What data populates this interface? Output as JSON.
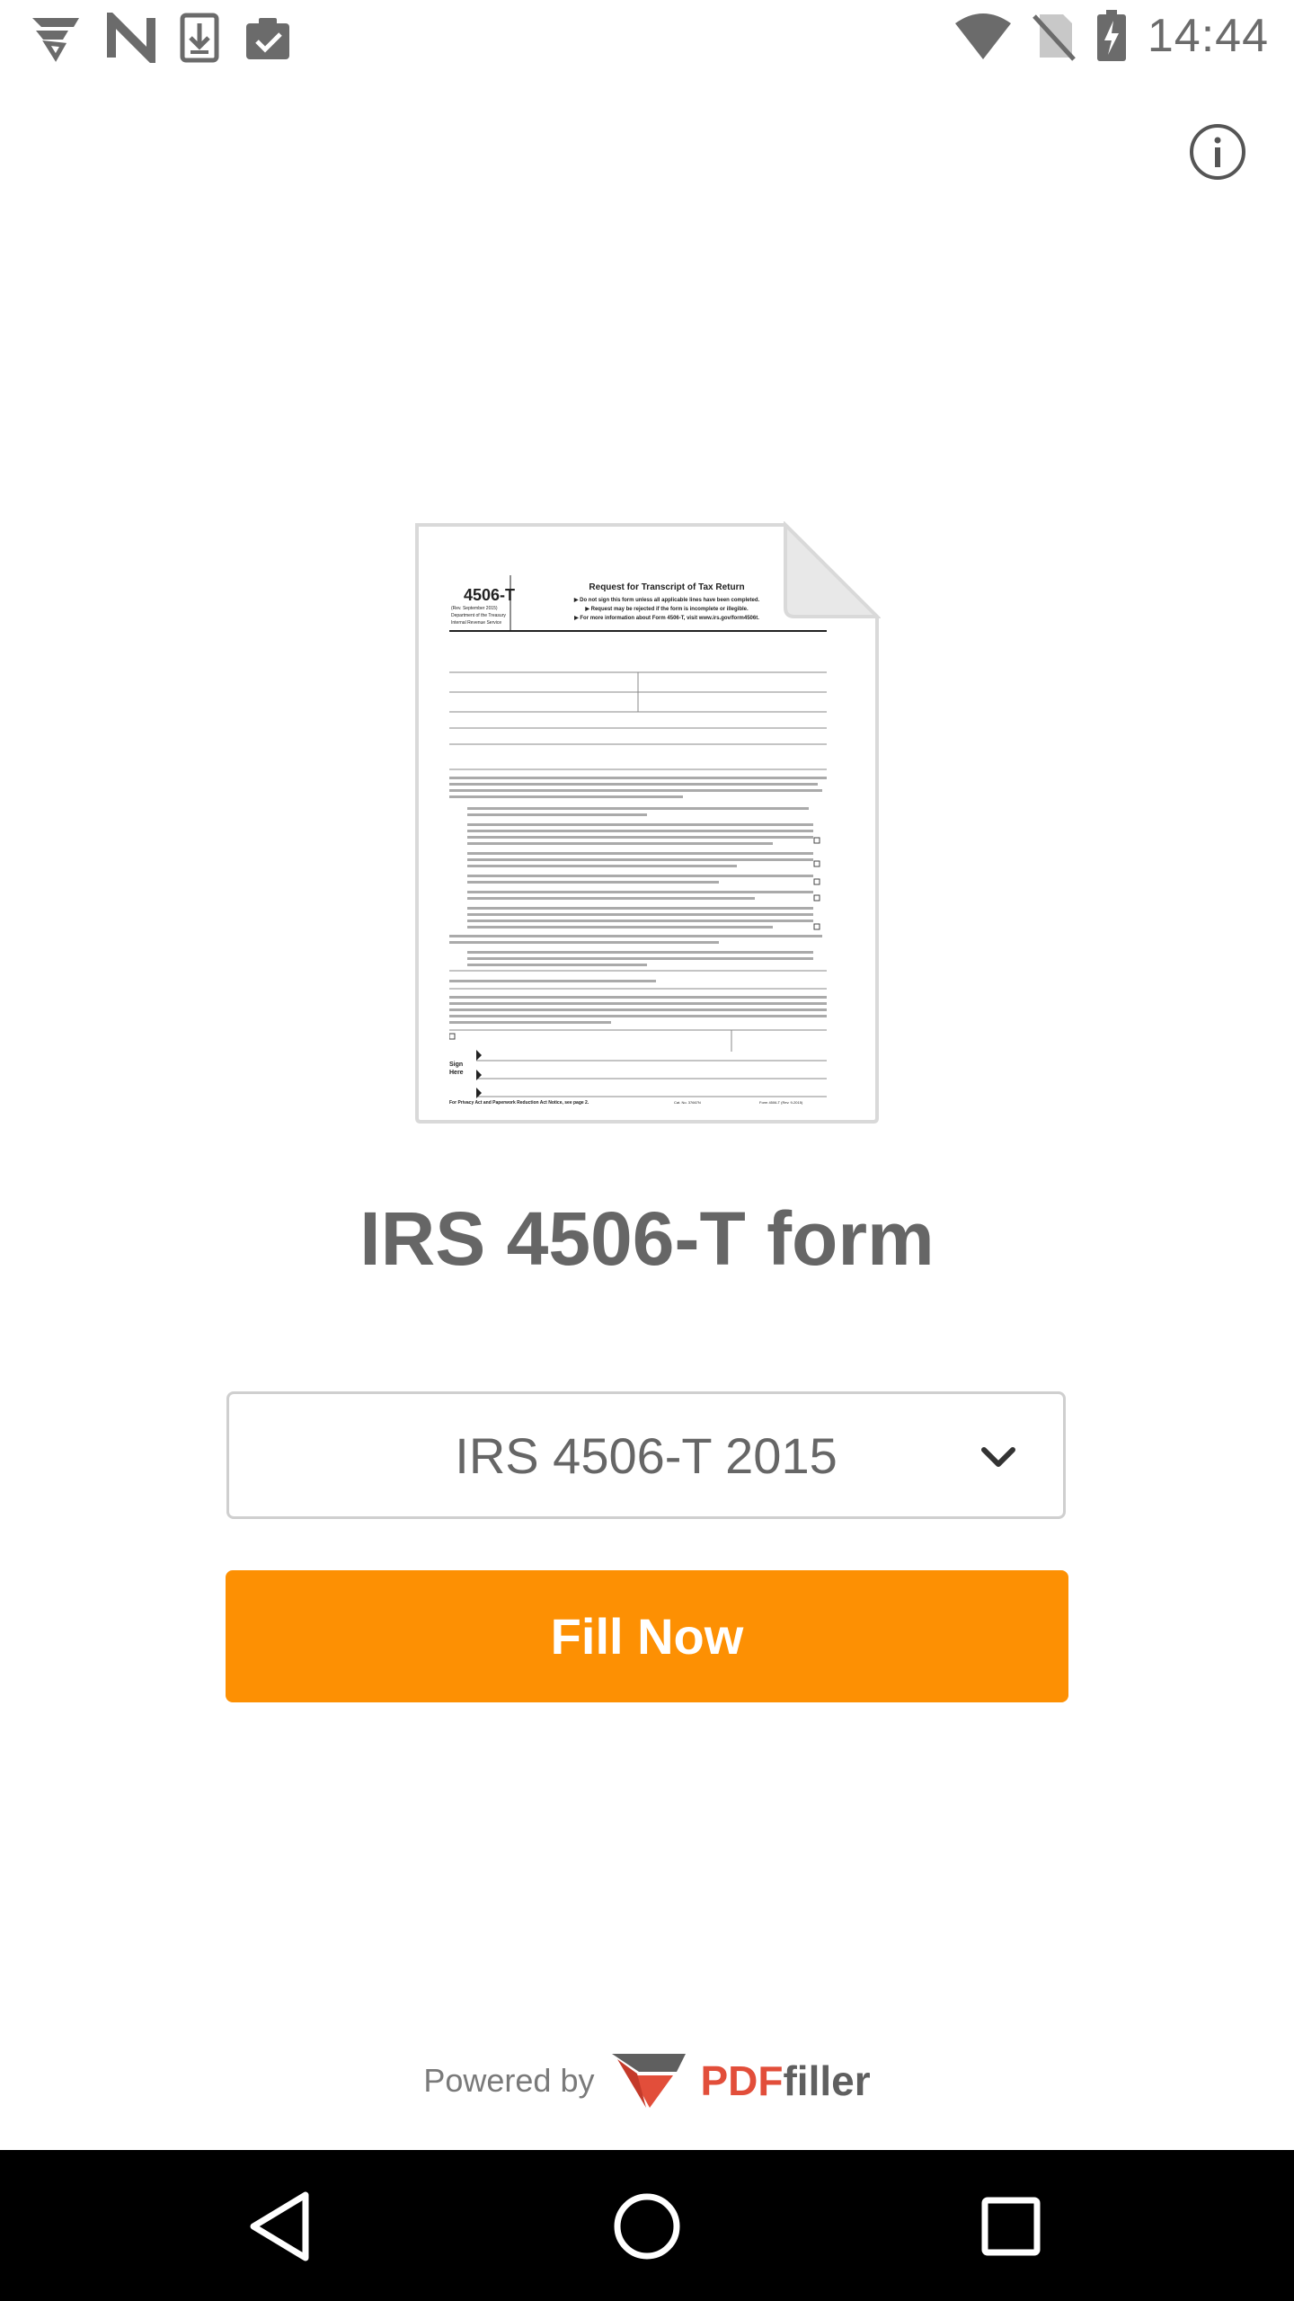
{
  "status_bar": {
    "time": "14:44",
    "left_icons": [
      "signal-app-icon",
      "n-icon",
      "download-icon",
      "clipboard-check-icon"
    ],
    "right_icons": [
      "wifi-icon",
      "no-sim-icon",
      "battery-charging-icon"
    ]
  },
  "header": {
    "info_icon": "info-icon"
  },
  "document": {
    "form_number": "4506-T",
    "form_title": "Request for Transcript of Tax Return",
    "form_line_1": "▶ Do not sign this form unless all applicable lines have been completed.",
    "form_line_2": "▶ Request may be rejected if the form is incomplete or illegible.",
    "form_line_3": "▶ For more information about Form 4506-T, visit www.irs.gov/form4506t.",
    "form_rev": "(Rev. September 2015)",
    "form_dept": "Department of the Treasury",
    "form_irs": "Internal Revenue Service",
    "sign_label": "Sign Here",
    "footer_left": "For Privacy Act and Paperwork Reduction Act Notice, see page 2.",
    "footer_mid": "Cat. No. 37667N",
    "footer_right": "Form 4506-T (Rev. 9-2015)"
  },
  "main": {
    "title": "IRS 4506-T form",
    "selected_version": "IRS 4506-T 2015",
    "fill_button_label": "Fill Now"
  },
  "footer": {
    "powered_by": "Powered by",
    "brand_part1": "PDF",
    "brand_part2": "filler"
  },
  "colors": {
    "accent": "#fd9003",
    "brand_red": "#e24e3a",
    "text_gray": "#666666"
  },
  "nav": {
    "icons": [
      "back-icon",
      "home-icon",
      "recents-icon"
    ]
  }
}
